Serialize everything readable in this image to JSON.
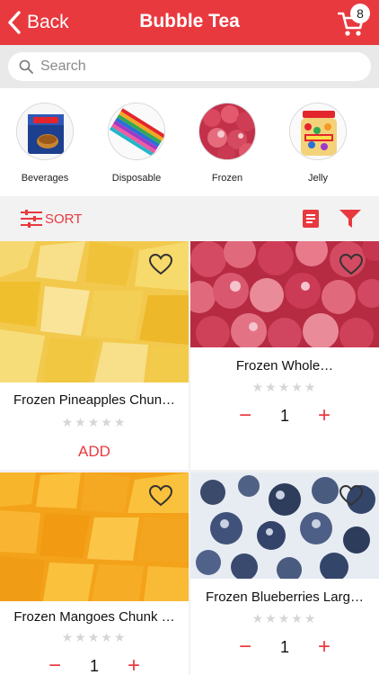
{
  "header": {
    "back_label": "Back",
    "title": "Bubble Tea",
    "cart_count": "8"
  },
  "search": {
    "placeholder": "Search"
  },
  "categories": [
    {
      "label": "Beverages",
      "icon": "tea-box-image"
    },
    {
      "label": "Disposable",
      "icon": "straws-image"
    },
    {
      "label": "Frozen",
      "icon": "frozen-berries-image"
    },
    {
      "label": "Jelly",
      "icon": "jelly-jar-image"
    }
  ],
  "toolbar": {
    "sort_label": "SORT"
  },
  "products": [
    {
      "name": "Frozen Pineapples Chun…",
      "rating": 0,
      "action_label": "ADD"
    },
    {
      "name": "Frozen Whole…",
      "rating": 0,
      "quantity": "1",
      "minus": "−",
      "plus": "+"
    },
    {
      "name": "Frozen Mangoes Chunk …",
      "rating": 0,
      "quantity": "1",
      "minus": "−",
      "plus": "+"
    },
    {
      "name": "Frozen Blueberries Larg…",
      "rating": 0,
      "quantity": "1",
      "minus": "−",
      "plus": "+"
    }
  ],
  "colors": {
    "accent": "#e8393f",
    "background": "#f2f2f2",
    "star_empty": "#d6d6d6"
  }
}
